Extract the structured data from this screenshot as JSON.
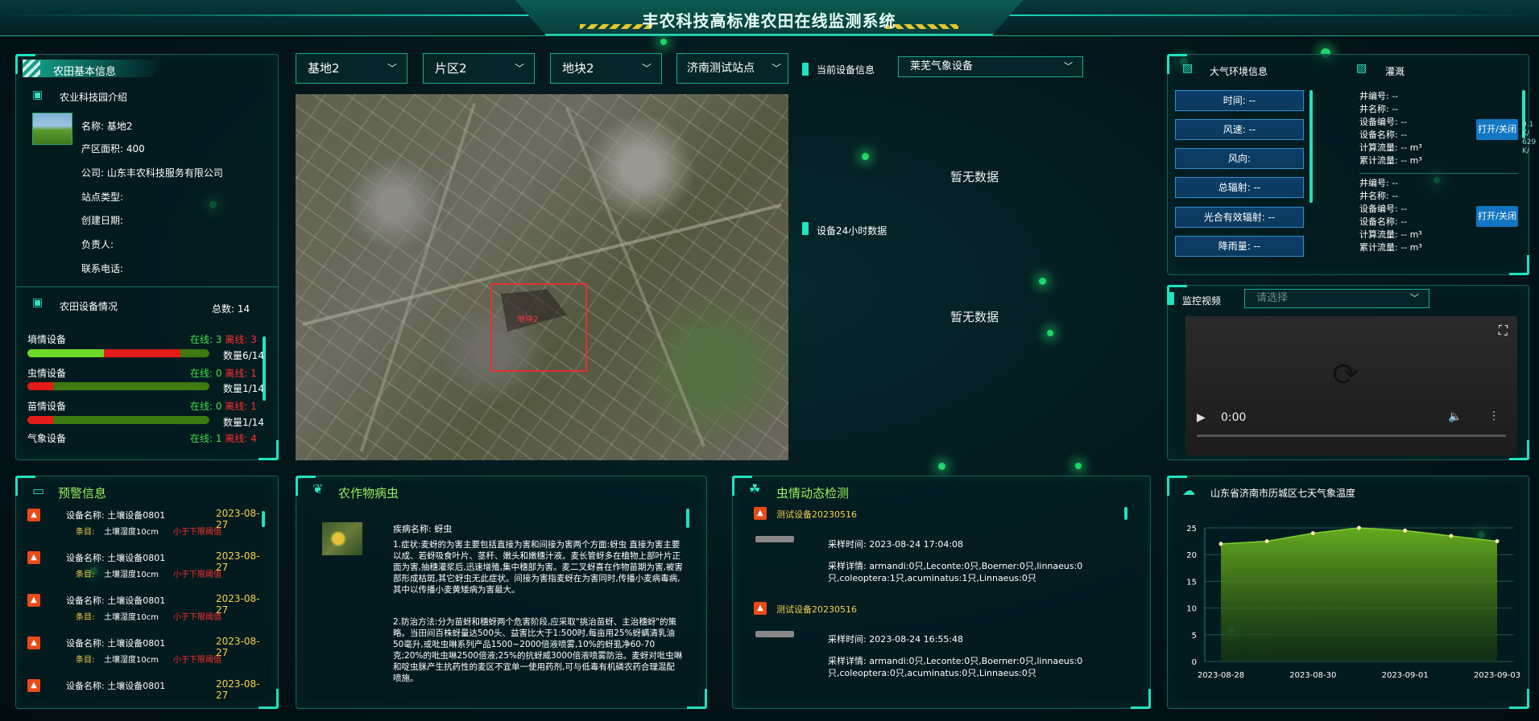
{
  "header": {
    "title": "丰农科技高标准农田在线监测系统"
  },
  "farm": {
    "title": "农田基本信息",
    "intro": "农业科技园介绍",
    "name_label": "名称:",
    "name": "基地2",
    "area_label": "产区面积:",
    "area": "400",
    "company_label": "公司:",
    "company": "山东丰农科技服务有限公司",
    "type_label": "站点类型:",
    "date_label": "创建日期:",
    "owner_label": "负责人:",
    "phone_label": "联系电话:"
  },
  "devices": {
    "title": "农田设备情况",
    "total": "总数: 14",
    "items": [
      {
        "name": "墒情设备",
        "online": "在线: 3",
        "offline": "离线: 3",
        "count": "数量6/14",
        "on": 0.21,
        "off": 0.21
      },
      {
        "name": "虫情设备",
        "online": "在线: 0",
        "offline": "离线: 1",
        "count": "数量1/14",
        "on": 0,
        "off": 0.07
      },
      {
        "name": "苗情设备",
        "online": "在线: 0",
        "offline": "离线: 1",
        "count": "数量1/14",
        "on": 0,
        "off": 0.07
      },
      {
        "name": "气象设备",
        "online": "在线: 1",
        "offline": "离线: 4",
        "count": "",
        "on": 0,
        "off": 0
      }
    ]
  },
  "filters": {
    "base": "基地2",
    "zone": "片区2",
    "plot": "地块2",
    "station": "济南测试站点"
  },
  "map": {
    "label": "地块2"
  },
  "current_device": {
    "label": "当前设备信息",
    "value": "莱芜气象设备",
    "no_data_1": "暂无数据",
    "h24_label": "设备24小时数据",
    "no_data_2": "暂无数据"
  },
  "atmosphere": {
    "title": "大气环境信息",
    "items": [
      "时间: --",
      "风速: --",
      "风向:",
      "总辐射: --",
      "光合有效辐射: --",
      "降雨量: --"
    ]
  },
  "irrigation": {
    "title": "灌溉",
    "toggle": "打开/关闭",
    "wells": [
      {
        "well_no": "井编号: --",
        "well_name": "井名称: --",
        "dev_no": "设备编号: --",
        "dev_name": "设备名称: --",
        "flow": "计算流量: -- m³",
        "total": "累计流量: -- m³"
      },
      {
        "well_no": "井编号: --",
        "well_name": "井名称: --",
        "dev_no": "设备编号: --",
        "dev_name": "设备名称: --",
        "flow": "计算流量: -- m³",
        "total": "累计流量: -- m³"
      }
    ],
    "side_1": "9.1",
    "side_2": "629",
    "side_unit": "K/"
  },
  "video": {
    "title": "监控视频",
    "placeholder": "请选择",
    "time": "0:00"
  },
  "warnings": {
    "title": "预警信息",
    "items": [
      {
        "name_label": "设备名称:",
        "name": "土壤设备0801",
        "date": "2023-08-27",
        "item_label": "条目:",
        "item": "土壤湿度10cm",
        "status": "小于下限阈值"
      },
      {
        "name_label": "设备名称:",
        "name": "土壤设备0801",
        "date": "2023-08-27",
        "item_label": "条目:",
        "item": "土壤湿度10cm",
        "status": "小于下限阈值"
      },
      {
        "name_label": "设备名称:",
        "name": "土壤设备0801",
        "date": "2023-08-27",
        "item_label": "条目:",
        "item": "土壤湿度10cm",
        "status": "小于下限阈值"
      },
      {
        "name_label": "设备名称:",
        "name": "土壤设备0801",
        "date": "2023-08-27",
        "item_label": "条目:",
        "item": "土壤湿度10cm",
        "status": "小于下限阈值"
      },
      {
        "name_label": "设备名称:",
        "name": "土壤设备0801",
        "date": "2023-08-27",
        "item_label": "",
        "item": "",
        "status": ""
      }
    ]
  },
  "pest": {
    "title": "农作物病虫",
    "disease_label": "疾病名称:",
    "disease": "蚜虫",
    "p1": "1.症状:麦蚜的为害主要包括直接为害和间接为害两个方面:蚜虫 直接为害主要以成、若蚜吸食叶片、茎秆、嫩头和嫩穗汁液。麦长管蚜多在植物上部叶片正面为害,抽穗灌浆后,迅速增殖,集中穗部为害。麦二叉蚜喜在作物苗期为害,被害部形成枯斑,其它蚜虫无此症状。间接为害指麦蚜在为害同时,传播小麦病毒病,其中以传播小麦黄矮病为害最大。",
    "p2": "2.防治方法:分为苗蚜和穗蚜两个危害阶段,应采取\"挑治苗蚜、主治穗蚜\"的策略。当田间百株蚜量达500头、益害比大于1:500时,每亩用25%蚜螨清乳油50毫升,或吡虫啉系列产品1500~2000倍液喷雾,10%的蚜虱净60-70克;20%的吡虫啉2500倍液;25%的抗蚜威3000倍液喷雾防治。麦蚜对吡虫啉和啶虫脒产生抗药性的麦区不宜单一使用药剂,可与低毒有机磷农药合理混配喷施。"
  },
  "insect": {
    "title": "虫情动态检测",
    "items": [
      {
        "device": "测试设备20230516",
        "time_label": "采样时间:",
        "time": "2023-08-24 17:04:08",
        "detail_label": "采样详情:",
        "detail": "armandi:0只,Leconte:0只,Boerner:0只,linnaeus:0只,coleoptera:1只,acuminatus:1只,Linnaeus:0只"
      },
      {
        "device": "测试设备20230516",
        "time_label": "采样时间:",
        "time": "2023-08-24 16:55:48",
        "detail_label": "采样详情:",
        "detail": "armandi:0只,Leconte:0只,Boerner:0只,linnaeus:0只,coleoptera:0只,acuminatus:0只,Linnaeus:0只"
      }
    ]
  },
  "weather": {
    "title": "山东省济南市历城区七天气象温度"
  },
  "chart_data": {
    "type": "area",
    "title": "山东省济南市历城区七天气象温度",
    "x": [
      "2023-08-28",
      "2023-08-29",
      "2023-08-30",
      "2023-08-31",
      "2023-09-01",
      "2023-09-02",
      "2023-09-03"
    ],
    "xticks": [
      "2023-08-28",
      "2023-08-30",
      "2023-09-01",
      "2023-09-03"
    ],
    "values": [
      22,
      22.5,
      24,
      25,
      24.5,
      23.5,
      22.5
    ],
    "ylim": [
      0,
      25
    ],
    "yticks": [
      0,
      5,
      10,
      15,
      20,
      25
    ],
    "grid": true,
    "color": "#6ab21e"
  },
  "colors": {
    "accent": "#1de4c1",
    "online": "#3fe04b",
    "offline": "#ff2f2f",
    "date": "#f6d34a"
  }
}
